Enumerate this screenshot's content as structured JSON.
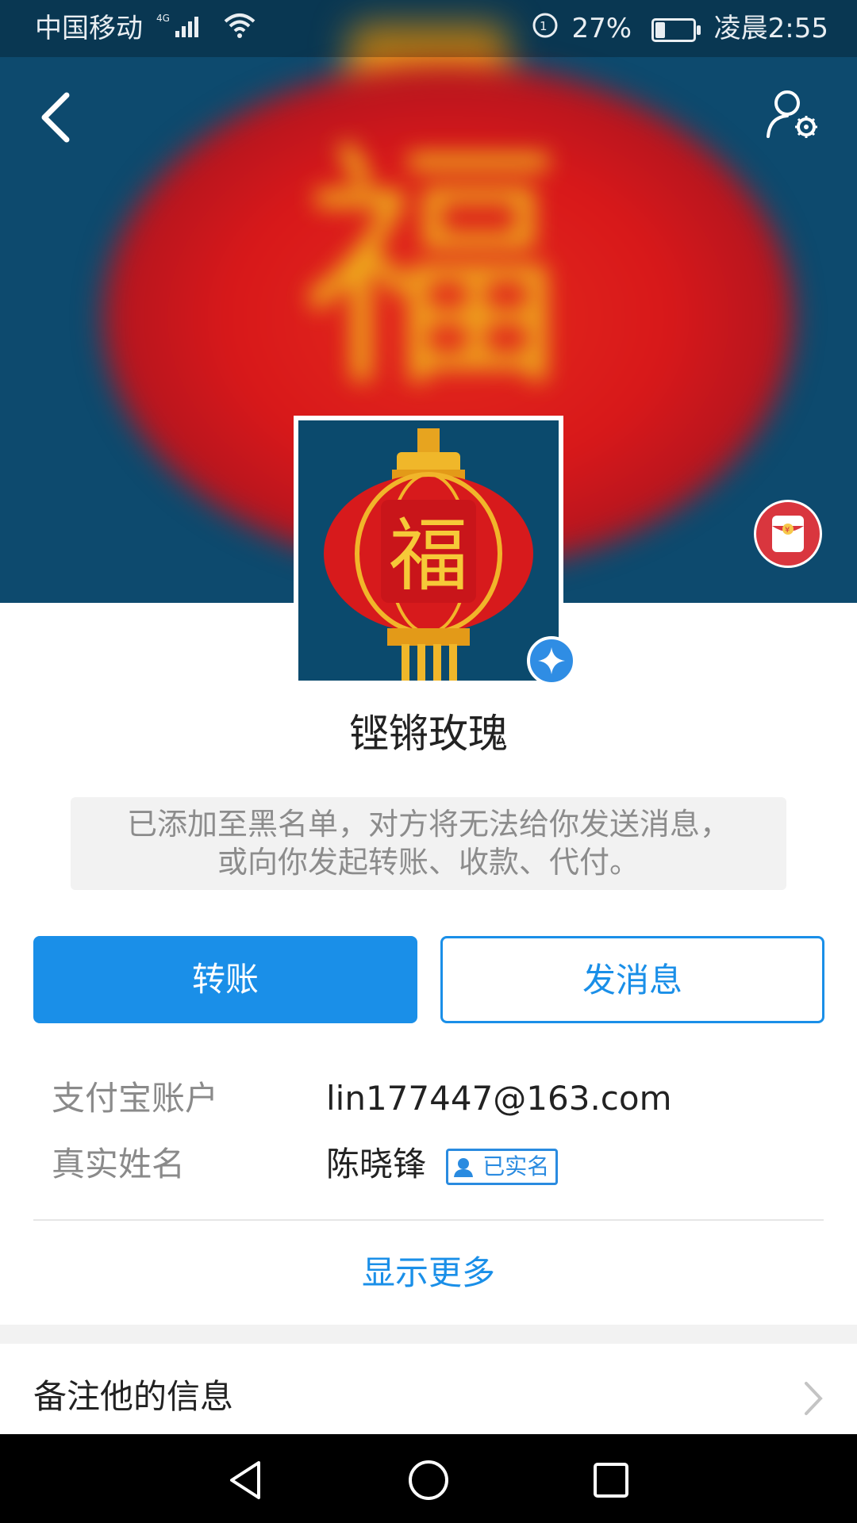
{
  "status_bar": {
    "carrier": "中国移动",
    "network": "4G",
    "battery_percent": "27%",
    "battery_level": 0.27,
    "time": "凌晨2:55"
  },
  "header": {
    "back_icon": "chevron-left-icon",
    "settings_icon": "user-settings-icon",
    "redpacket_icon": "red-packet-icon"
  },
  "profile": {
    "nickname": "铿锵玫瑰",
    "avatar_char": "福",
    "blacklist_notice_line1": "已添加至黑名单，对方将无法给你发送消息，",
    "blacklist_notice_line2": "或向你发起转账、收款、代付。"
  },
  "actions": {
    "transfer_label": "转账",
    "message_label": "发消息"
  },
  "info": {
    "account_label": "支付宝账户",
    "account_value": "lin177447@163.com",
    "realname_label": "真实姓名",
    "realname_value": "陈晓锋",
    "verified_label": "已实名"
  },
  "show_more_label": "显示更多",
  "remark_label": "备注他的信息",
  "colors": {
    "accent": "#1a8fe8",
    "banner": "#0d4a6e",
    "lantern_red": "#d8181a",
    "lantern_gold": "#f2c51c"
  }
}
